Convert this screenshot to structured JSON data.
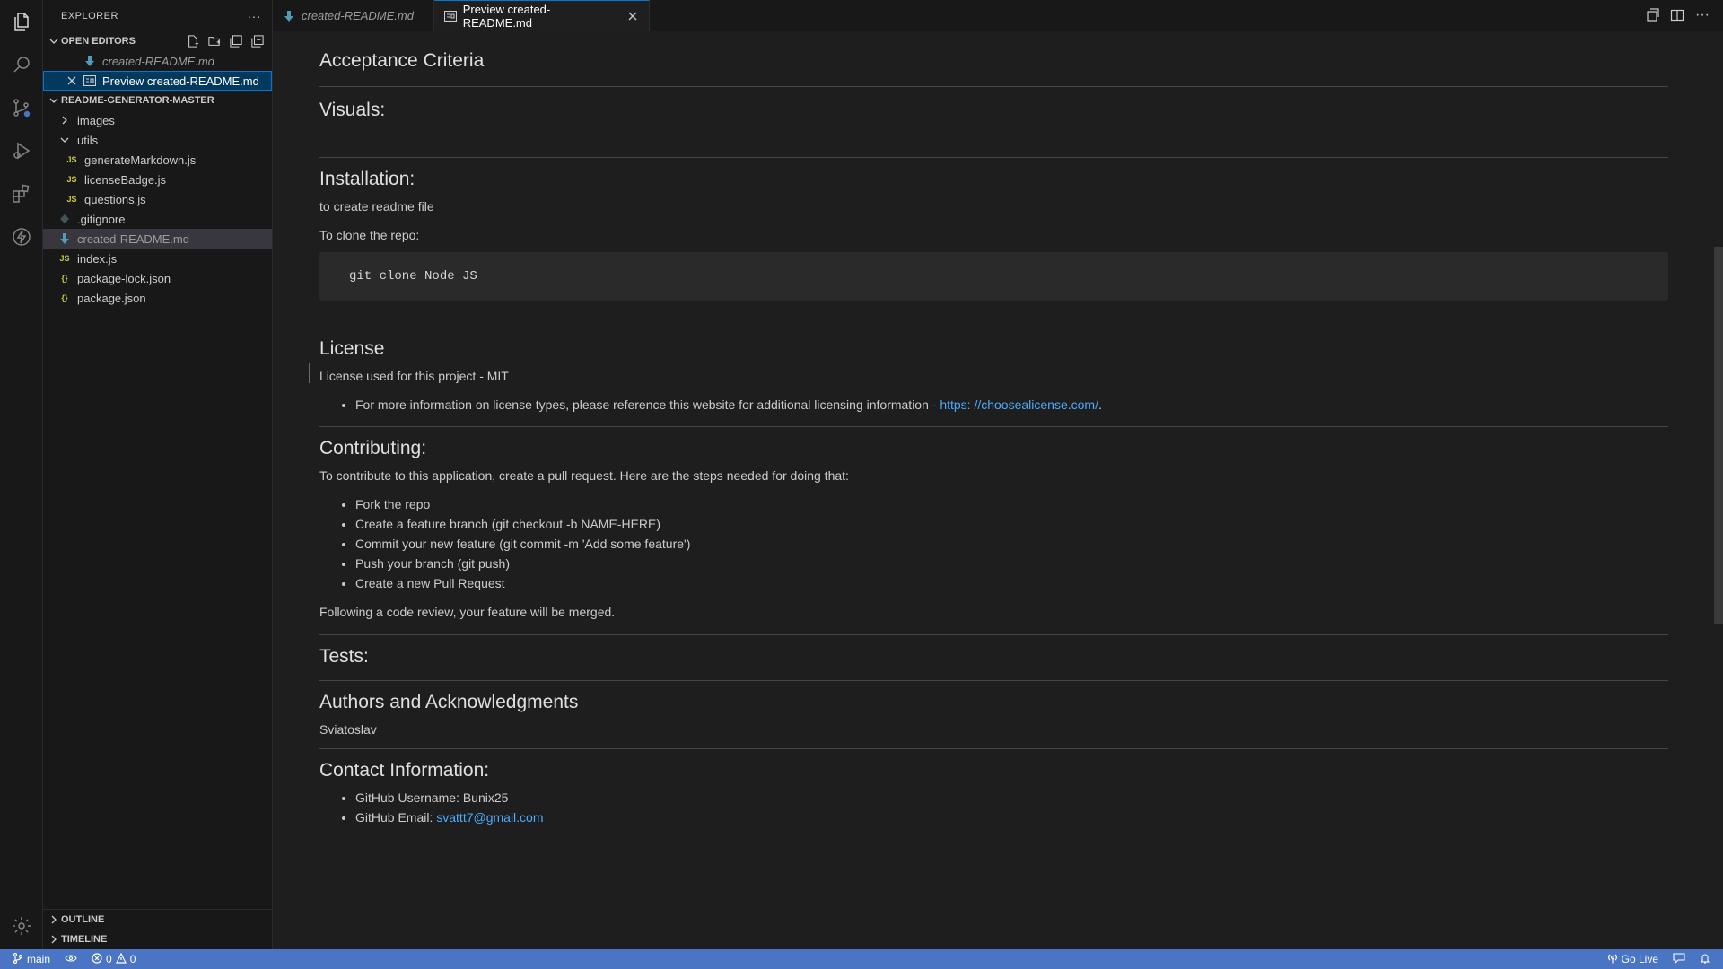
{
  "sidebar": {
    "title": "EXPLORER",
    "open_editors": {
      "title": "OPEN EDITORS",
      "items": [
        {
          "label": "created-README.md"
        },
        {
          "label": "Preview created-README.md"
        }
      ]
    },
    "project": {
      "title": "README-GENERATOR-MASTER",
      "items": [
        {
          "label": "images"
        },
        {
          "label": "utils"
        },
        {
          "label": "generateMarkdown.js"
        },
        {
          "label": "licenseBadge.js"
        },
        {
          "label": "questions.js"
        },
        {
          "label": ".gitignore"
        },
        {
          "label": "created-README.md"
        },
        {
          "label": "index.js"
        },
        {
          "label": "package-lock.json"
        },
        {
          "label": "package.json"
        }
      ]
    },
    "outline": "OUTLINE",
    "timeline": "TIMELINE"
  },
  "tabs": [
    {
      "label": "created-README.md"
    },
    {
      "label": "Preview created-README.md"
    }
  ],
  "file_icon_labels": {
    "js": "JS",
    "json": "{}"
  },
  "doc": {
    "acceptance": "Acceptance Criteria",
    "visuals": "Visuals:",
    "installation": "Installation:",
    "install_text": "to create readme file",
    "clone_text": "To clone the repo:",
    "code": "git clone Node JS",
    "license": "License",
    "license_text": "License used for this project - MIT",
    "license_bullet": "For more information on license types, please reference this website for additional licensing information - ",
    "license_link": "https: //choosealicense.com/",
    "license_bullet_end": ".",
    "contributing": "Contributing:",
    "contrib_text": "To contribute to this application, create a pull request. Here are the steps needed for doing that:",
    "contrib_steps": [
      "Fork the repo",
      "Create a feature branch (git checkout -b NAME-HERE)",
      "Commit your new feature (git commit -m 'Add some feature')",
      "Push your branch (git push)",
      "Create a new Pull Request"
    ],
    "contrib_end": "Following a code review, your feature will be merged.",
    "tests": "Tests:",
    "authors": "Authors and Acknowledgments",
    "authors_text": "Sviatoslav",
    "contact": "Contact Information:",
    "github_user_label": "GitHub Username: ",
    "github_user": "Bunix25",
    "github_email_label": "GitHub Email: ",
    "github_email": "svattt7@gmail.com"
  },
  "status": {
    "branch": "main",
    "errors": "0",
    "warnings": "0",
    "go_live": "Go Live"
  },
  "colors": {
    "accent": "#0078d4",
    "status_bar": "#4a75c5",
    "link": "#4daafc"
  }
}
